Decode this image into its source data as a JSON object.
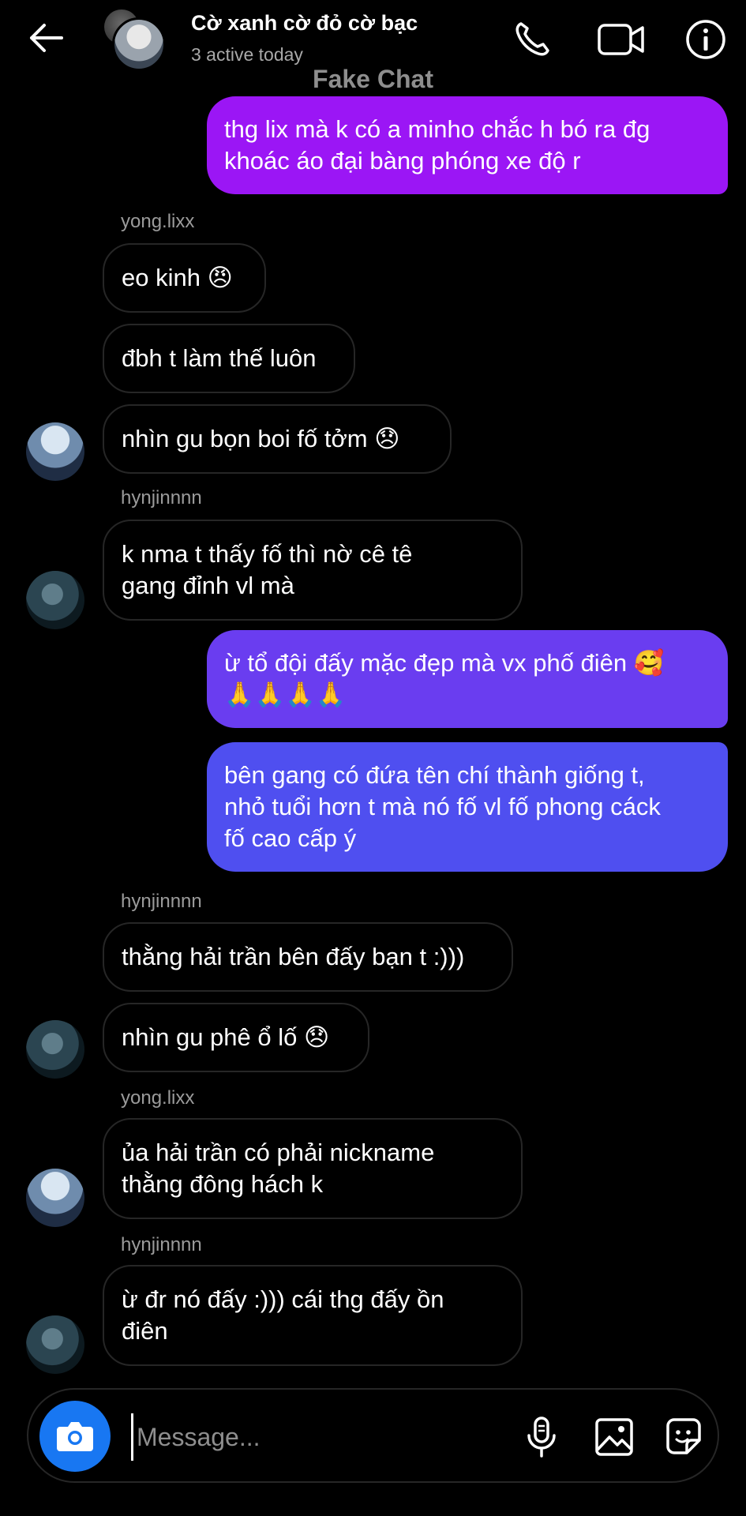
{
  "header": {
    "title": "Cờ xanh cờ đỏ cờ bạc",
    "subtitle": "3 active today",
    "icons": [
      "back-arrow-icon",
      "phone-icon",
      "video-icon",
      "info-icon"
    ]
  },
  "watermark": "Fake Chat",
  "messages": [
    {
      "type": "out",
      "text": "thg lix mà k có a minho chắc h bó ra đg\nkhoác áo đại bàng phóng xe độ r",
      "color": "#9b16f5"
    },
    {
      "type": "sender",
      "text": "yong.lixx"
    },
    {
      "type": "in",
      "text": "eo kinh 😠"
    },
    {
      "type": "in",
      "text": "đbh t làm thế luôn"
    },
    {
      "type": "in",
      "text": "nhìn gu bọn boi fố tởm 😞"
    },
    {
      "type": "sender",
      "text": "hynjinnnn"
    },
    {
      "type": "in",
      "text": "k nma t thấy fố thì nờ cê tê\ngang đỉnh vl mà"
    },
    {
      "type": "out",
      "text": "ừ tổ đội đấy mặc đẹp mà vx phố điên 🥰\n🙏🙏🙏🙏",
      "color": "#6a3df0"
    },
    {
      "type": "out",
      "text": "bên gang có đứa tên chí thành giống t,\nnhỏ tuổi hơn t mà nó fố vl fố phong cáck\nfố cao cấp ý",
      "color": "#4f4ff0"
    },
    {
      "type": "sender",
      "text": "hynjinnnn"
    },
    {
      "type": "in",
      "text": "thằng hải trần bên đấy bạn t :)))"
    },
    {
      "type": "in",
      "text": "nhìn gu phê ổ lố 😞"
    },
    {
      "type": "sender",
      "text": "yong.lixx"
    },
    {
      "type": "in",
      "text": "ủa hải trần có phải nickname\nthằng đông hách k"
    },
    {
      "type": "sender",
      "text": "hynjinnnn"
    },
    {
      "type": "in",
      "text": "ừ đr nó đấy :))) cái thg đấy ồn\nđiên"
    }
  ],
  "composer": {
    "placeholder": "Message...",
    "accent": "#1877f2",
    "icons": [
      "camera-icon",
      "microphone-icon",
      "gallery-icon",
      "sticker-icon"
    ]
  }
}
